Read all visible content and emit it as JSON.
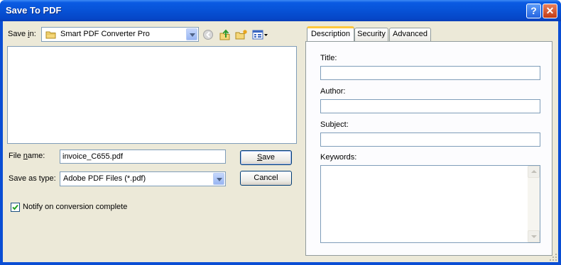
{
  "window": {
    "title": "Save To PDF",
    "help_glyph": "?",
    "close_glyph": "✕"
  },
  "save_in": {
    "label_prefix": "Save ",
    "label_underline": "i",
    "label_suffix": "n:",
    "folder_name": "Smart PDF Converter Pro",
    "folder_icon": "folder-icon",
    "toolbar_icons": [
      "back-icon",
      "up-folder-icon",
      "new-folder-icon",
      "view-menu-icon"
    ]
  },
  "file_name": {
    "label_prefix": "File ",
    "label_underline": "n",
    "label_suffix": "ame:",
    "value": "invoice_C655.pdf"
  },
  "save_as_type": {
    "label": "Save as type:",
    "value": "Adobe PDF Files (*.pdf)"
  },
  "buttons": {
    "save_underline": "S",
    "save_rest": "ave",
    "cancel": "Cancel"
  },
  "notify": {
    "label": "Notify on conversion complete",
    "checked": true
  },
  "tabs": [
    {
      "label": "Description",
      "active": true
    },
    {
      "label": "Security",
      "active": false
    },
    {
      "label": "Advanced",
      "active": false
    }
  ],
  "description": {
    "title_label": "Title:",
    "title_value": "",
    "author_label": "Author:",
    "author_value": "",
    "subject_label": "Subject:",
    "subject_value": "",
    "keywords_label": "Keywords:",
    "keywords_value": ""
  },
  "colors": {
    "title_bar": "#0752d6",
    "dialog_face": "#ece9d8",
    "input_border": "#7f9db9",
    "active_tab_accent": "#ffc83c",
    "close_button": "#c33b14",
    "checkmark": "#21a121"
  }
}
